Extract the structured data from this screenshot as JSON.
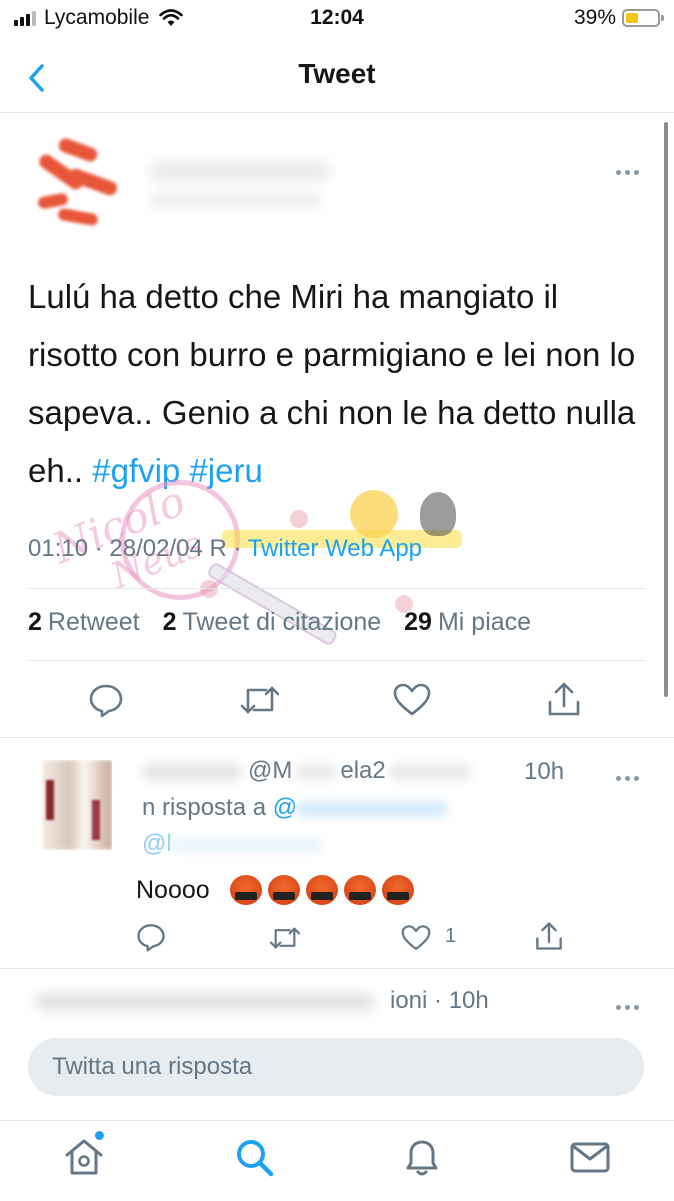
{
  "status_bar": {
    "carrier": "Lycamobile",
    "time": "12:04",
    "battery": "39%",
    "battery_level": 0.39,
    "colors": {
      "battery_fill": "#f5c518"
    }
  },
  "nav": {
    "title": "Tweet",
    "back_icon": "chevron-left-icon"
  },
  "tweet": {
    "text_plain": "Lulú ha detto che Miri ha mangiato il risotto con burro e parmigiano e lei non lo sapeva.. Genio a chi non le ha detto nulla eh.. ",
    "hashtags": [
      "#gfvip",
      "#jeru"
    ],
    "time": "01:10 · 28/02/04 R",
    "separator": " · ",
    "source": "Twitter Web App",
    "stats": {
      "retweets_count": "2",
      "retweets_label": "Retweet",
      "quotes_count": "2",
      "quotes_label": "Tweet di citazione",
      "likes_count": "29",
      "likes_label": "Mi piace"
    },
    "actions": [
      "reply-icon",
      "retweet-icon",
      "like-icon",
      "share-icon"
    ]
  },
  "reply": {
    "handle": "@M",
    "handle_tail": "ela2",
    "time": "10h",
    "replying_prefix": "n risposta a",
    "mention": "@",
    "mention2": "@l",
    "text": "Noooo",
    "emoji_count": 5,
    "like_count": "1",
    "actions": [
      "reply-icon",
      "retweet-icon",
      "like-icon",
      "share-icon"
    ]
  },
  "reply2": {
    "text": "ioni · 10h"
  },
  "compose": {
    "placeholder": "Twitta una risposta"
  },
  "tab_bar": {
    "items": [
      "home-icon",
      "search-icon",
      "notifications-icon",
      "messages-icon"
    ]
  },
  "watermark": {
    "line1": "Nicolo",
    "line2": "Neus"
  },
  "colors": {
    "accent": "#1da1f2",
    "secondary_text": "#657786",
    "primary_text": "#14171a",
    "divider": "#e1e8ed"
  }
}
